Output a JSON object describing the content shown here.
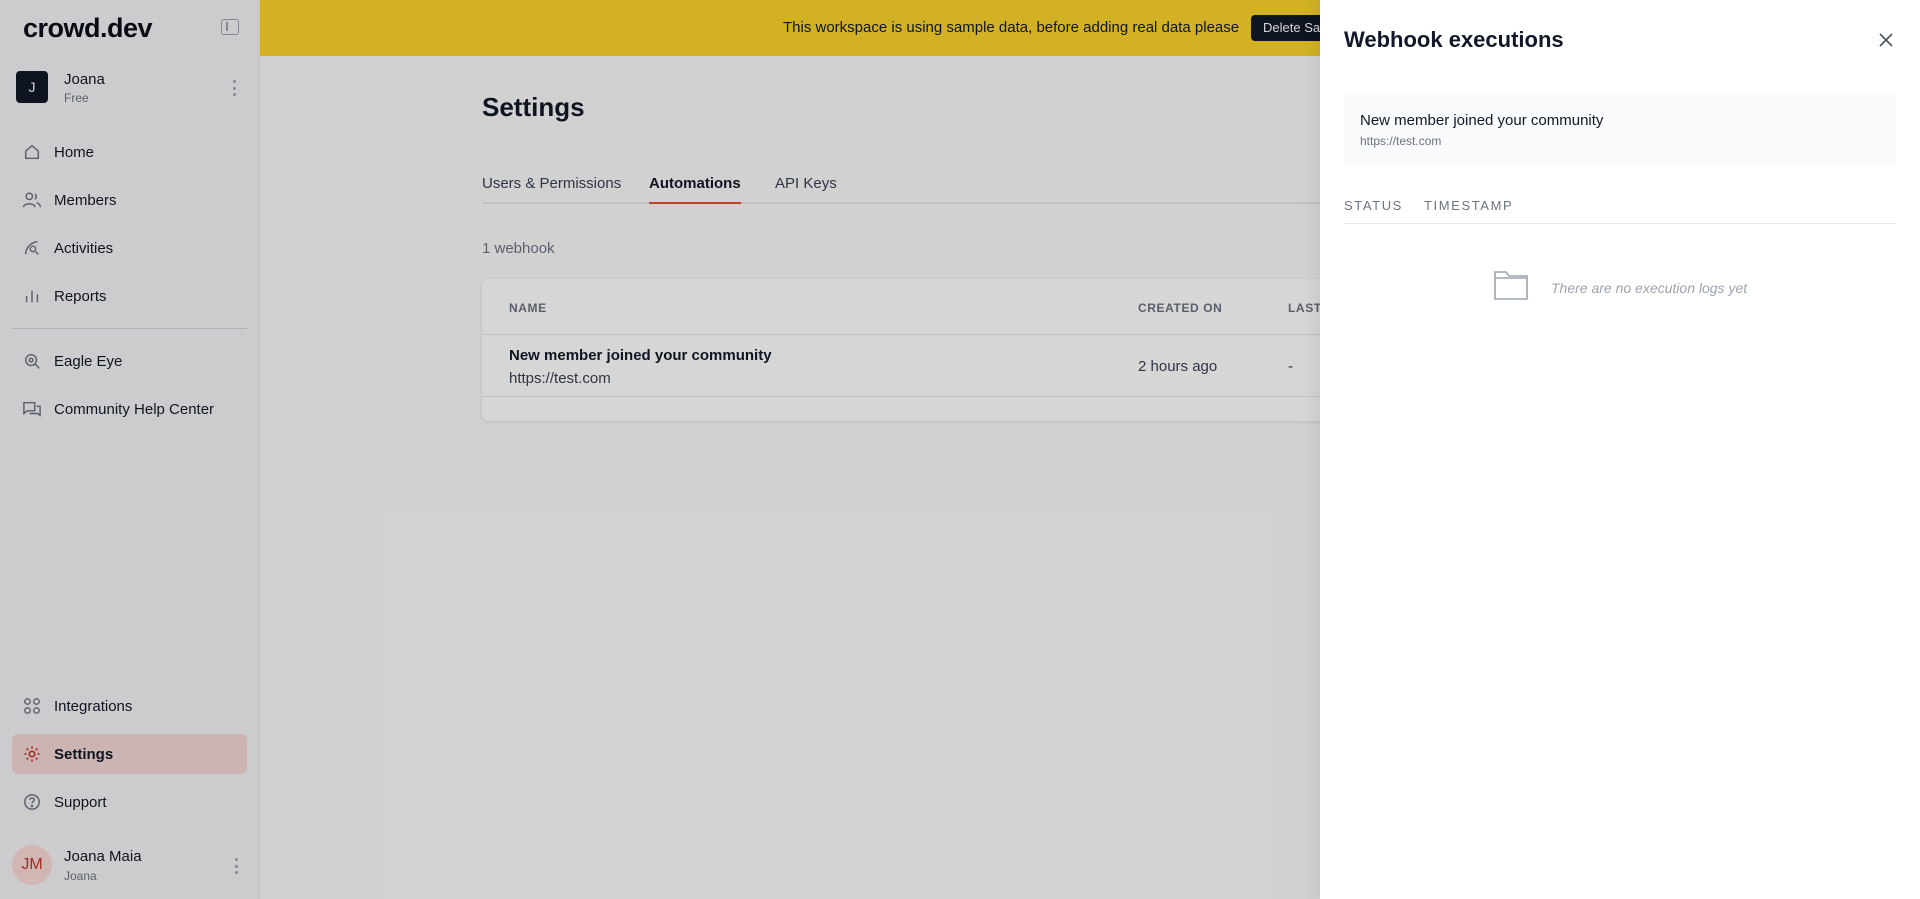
{
  "app": {
    "logo": "crowd.dev"
  },
  "workspace": {
    "initial": "J",
    "name": "Joana",
    "plan": "Free"
  },
  "sidebar": {
    "items": [
      {
        "label": "Home",
        "icon": "home-icon"
      },
      {
        "label": "Members",
        "icon": "members-icon"
      },
      {
        "label": "Activities",
        "icon": "activities-icon"
      },
      {
        "label": "Reports",
        "icon": "reports-icon"
      },
      {
        "label": "Eagle Eye",
        "icon": "eagle-eye-icon"
      },
      {
        "label": "Community Help Center",
        "icon": "help-center-icon"
      },
      {
        "label": "Integrations",
        "icon": "integrations-icon"
      },
      {
        "label": "Settings",
        "icon": "gear-icon"
      },
      {
        "label": "Support",
        "icon": "support-icon"
      }
    ],
    "active": "Settings"
  },
  "user": {
    "initials": "JM",
    "name": "Joana Maia",
    "workspace": "Joana"
  },
  "banner": {
    "text": "This workspace is using sample data, before adding real data please",
    "button_label": "Delete Sa"
  },
  "page": {
    "title": "Settings",
    "tabs": [
      {
        "label": "Users & Permissions"
      },
      {
        "label": "Automations"
      },
      {
        "label": "API Keys"
      }
    ],
    "active_tab": "Automations",
    "count_text": "1 webhook",
    "table": {
      "headers": {
        "name": "NAME",
        "created": "CREATED ON",
        "last": "LAST"
      },
      "rows": [
        {
          "name": "New member joined your community",
          "url": "https://test.com",
          "created": "2 hours ago",
          "last": "-"
        }
      ]
    }
  },
  "drawer": {
    "title": "Webhook executions",
    "webhook": {
      "name": "New member joined your community",
      "url": "https://test.com"
    },
    "headers": {
      "status": "STATUS",
      "timestamp": "TIMESTAMP"
    },
    "empty_text": "There are no execution logs yet"
  },
  "colors": {
    "banner": "#fbd52b",
    "accent": "#e94f2e",
    "active_nav_bg": "#f4d7d5",
    "dark": "#111827"
  }
}
